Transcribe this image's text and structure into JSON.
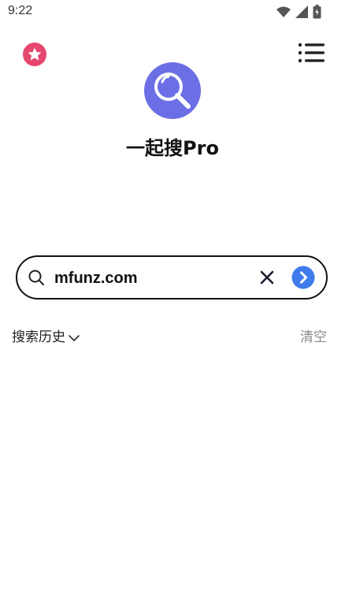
{
  "status_bar": {
    "time": "9:22",
    "icons": [
      "wifi-icon",
      "cellular-icon",
      "battery-icon"
    ]
  },
  "header": {
    "left_icon": "star-icon",
    "right_icon": "menu-icon",
    "logo_icon": "search-logo-icon",
    "title": "一起搜Pro"
  },
  "search": {
    "value": "mfunz.com",
    "placeholder": "",
    "search_icon": "search-icon",
    "clear_icon": "close-icon",
    "submit_icon": "arrow-right-icon"
  },
  "history": {
    "label": "搜索历史",
    "toggle_icon": "chevron-down-icon",
    "clear_label": "清空"
  },
  "colors": {
    "accent": "#5c6de8",
    "logo_bg": "#6c6ee5",
    "star_bg": "#e5476f",
    "go_button": "#3f7bea"
  }
}
